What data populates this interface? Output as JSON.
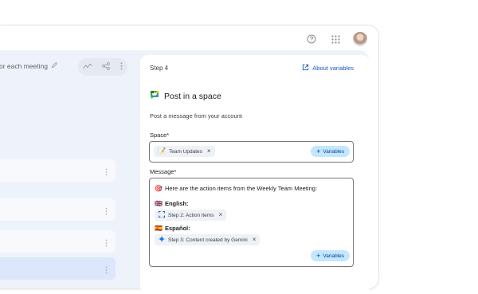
{
  "colors": {
    "accent": "#1a56c4",
    "variables_bg": "#c2e7ff",
    "active_card": "#dce7fb"
  },
  "topbar": {
    "help_icon": "help-circle-icon",
    "apps_icon": "apps-grid-icon"
  },
  "left_pane": {
    "title": "or each meeting",
    "cards": [
      {
        "state": "normal"
      },
      {
        "state": "normal"
      },
      {
        "state": "normal"
      },
      {
        "state": "active"
      }
    ]
  },
  "panel": {
    "step": "Step 4",
    "about_link": "About variables",
    "title": "Post in a space",
    "description": "Post a message from your account",
    "space": {
      "label": "Space*",
      "chip": "Team Updates",
      "chip_emoji": "📝",
      "variables": "Variables"
    },
    "message": {
      "label": "Message*",
      "line1_emoji": "🎯",
      "line1": "Here are the action items from the Weekly Team Meeting:",
      "english_flag": "🇬🇧",
      "english": "English:",
      "step2_chip": "Step 2: Action items",
      "spanish_flag": "🇪🇸",
      "spanish": "Español:",
      "step3_chip": "Step 3: Content created by Gemini",
      "variables": "Variables"
    }
  }
}
